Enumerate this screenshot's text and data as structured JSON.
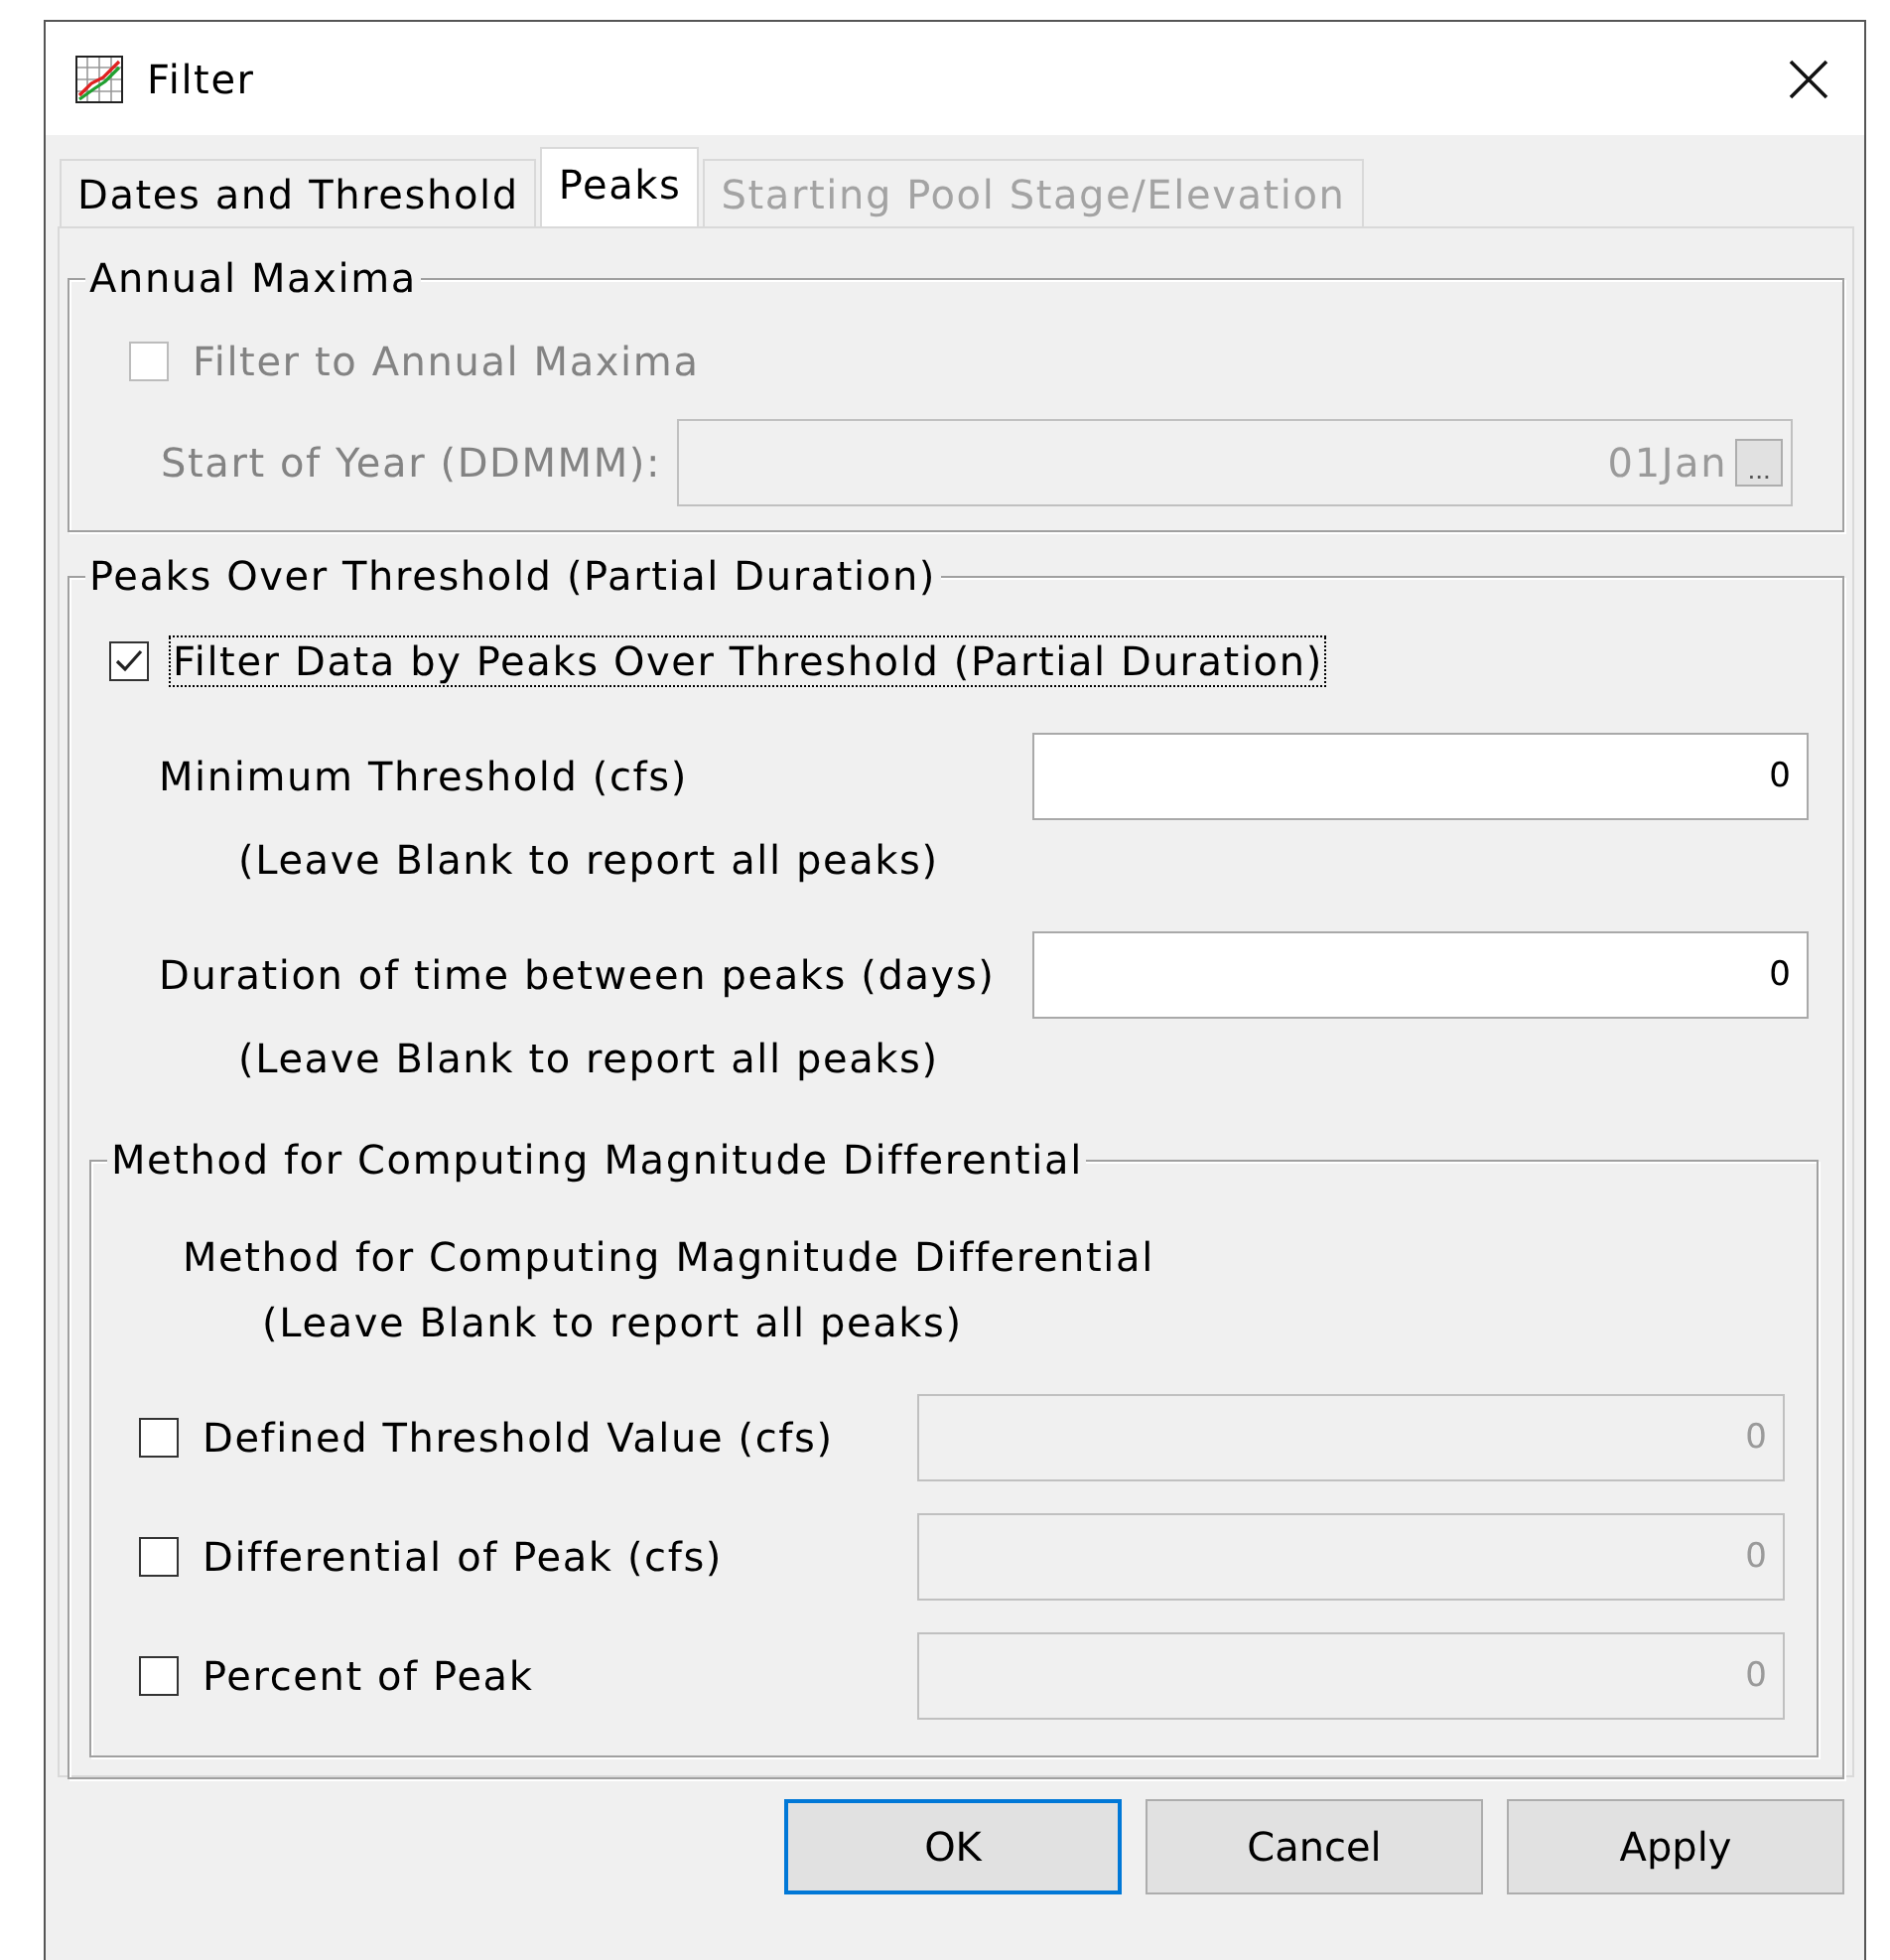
{
  "window": {
    "title": "Filter"
  },
  "tabs": [
    {
      "label": "Dates and Threshold",
      "selected": false,
      "disabled": false
    },
    {
      "label": "Peaks",
      "selected": true,
      "disabled": false
    },
    {
      "label": "Starting Pool Stage/Elevation",
      "selected": false,
      "disabled": true
    }
  ],
  "annual_maxima": {
    "title": "Annual Maxima",
    "checkbox": {
      "label": "Filter to Annual Maxima",
      "checked": false,
      "disabled": true
    },
    "start_of_year": {
      "label": "Start of Year (DDMMM):",
      "value": "01Jan",
      "button": "...",
      "disabled": true
    }
  },
  "peaks_over_threshold": {
    "title": "Peaks Over Threshold (Partial Duration)",
    "checkbox": {
      "label": "Filter Data by Peaks Over Threshold (Partial Duration)",
      "checked": true,
      "focused": true
    },
    "fields": [
      {
        "label": "Minimum Threshold (cfs)",
        "value": "0",
        "hint": "(Leave Blank to report all peaks)"
      },
      {
        "label": "Duration of time between peaks (days)",
        "value": "0",
        "hint": "(Leave Blank to report all peaks)"
      }
    ],
    "method": {
      "title": "Method for Computing Magnitude Differential",
      "heading": "Method for Computing Magnitude Differential",
      "hint": "(Leave Blank to report all peaks)",
      "options": [
        {
          "label": "Defined Threshold Value (cfs)",
          "checked": false,
          "value": "0",
          "disabled": true
        },
        {
          "label": "Differential of Peak (cfs)",
          "checked": false,
          "value": "0",
          "disabled": true
        },
        {
          "label": "Percent of Peak",
          "checked": false,
          "value": "0",
          "disabled": true
        }
      ]
    }
  },
  "buttons": [
    {
      "label": "OK",
      "default": true
    },
    {
      "label": "Cancel",
      "default": false
    },
    {
      "label": "Apply",
      "default": false
    }
  ]
}
